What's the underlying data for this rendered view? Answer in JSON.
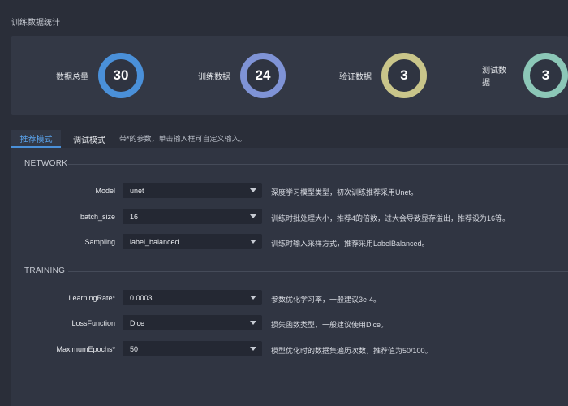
{
  "page_title": "训练数据统计",
  "stats": [
    {
      "label": "数据总量",
      "value": "30",
      "color": "#4a90d9"
    },
    {
      "label": "训练数据",
      "value": "24",
      "color": "#7f93d6"
    },
    {
      "label": "验证数据",
      "value": "3",
      "color": "#c9c58a"
    },
    {
      "label": "测试数据",
      "value": "3",
      "color": "#8cc7b7"
    }
  ],
  "tabs": [
    {
      "label": "推荐模式",
      "active": true
    },
    {
      "label": "调试模式",
      "active": false
    }
  ],
  "tab_hint": "带*的参数，单击输入框可自定义输入。",
  "sections": {
    "network": "NETWORK",
    "training": "TRAINING"
  },
  "fields": {
    "model": {
      "label": "Model",
      "value": "unet",
      "hint": "深度学习模型类型，初次训练推荐采用Unet。"
    },
    "batch_size": {
      "label": "batch_size",
      "value": "16",
      "hint": "训练时批处理大小，推荐4的倍数，过大会导致显存溢出，推荐设为16等。"
    },
    "sampling": {
      "label": "Sampling",
      "value": "label_balanced",
      "hint": "训练时输入采样方式，推荐采用LabelBalanced。"
    },
    "learning_rate": {
      "label": "LearningRate*",
      "value": "0.0003",
      "hint": "参数优化学习率，一般建议3e-4。"
    },
    "loss_function": {
      "label": "LossFunction",
      "value": "Dice",
      "hint": "损失函数类型，一般建议使用Dice。"
    },
    "max_epochs": {
      "label": "MaximumEpochs*",
      "value": "50",
      "hint": "模型优化时的数据集遍历次数，推荐值为50/100。"
    }
  },
  "icons": {
    "dropdown": "chevron-down-icon"
  }
}
